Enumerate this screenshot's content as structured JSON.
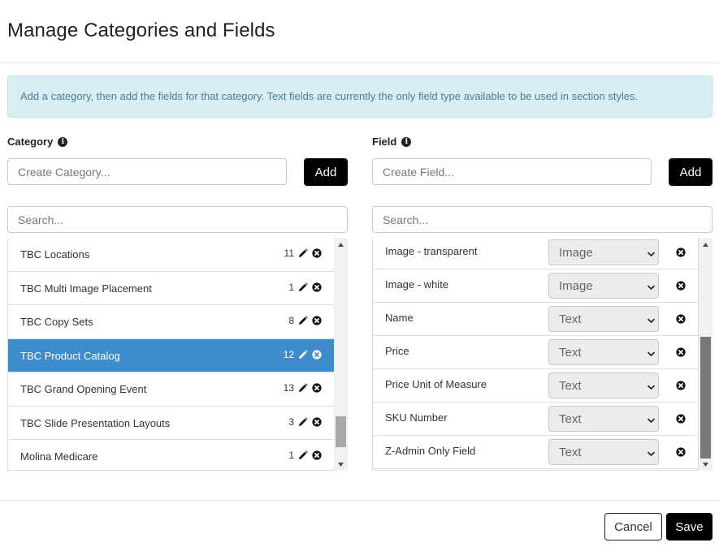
{
  "modal": {
    "title": "Manage Categories and Fields",
    "info_text": "Add a category, then add the fields for that category. Text fields are currently the only field type available to be used in section styles."
  },
  "category": {
    "label": "Category",
    "create_placeholder": "Create Category...",
    "add_label": "Add",
    "search_placeholder": "Search...",
    "items": [
      {
        "name": "TBC Locations",
        "count": "11",
        "active": false
      },
      {
        "name": "TBC Multi Image Placement",
        "count": "1",
        "active": false
      },
      {
        "name": "TBC Copy Sets",
        "count": "8",
        "active": false
      },
      {
        "name": "TBC Product Catalog",
        "count": "12",
        "active": true
      },
      {
        "name": "TBC Grand Opening Event",
        "count": "13",
        "active": false
      },
      {
        "name": "TBC Slide Presentation Layouts",
        "count": "3",
        "active": false
      },
      {
        "name": "Molina Medicare",
        "count": "1",
        "active": false
      }
    ]
  },
  "field": {
    "label": "Field",
    "create_placeholder": "Create Field...",
    "add_label": "Add",
    "search_placeholder": "Search...",
    "items": [
      {
        "name": "Image - transparent",
        "type": "Image"
      },
      {
        "name": "Image - white",
        "type": "Image"
      },
      {
        "name": "Name",
        "type": "Text"
      },
      {
        "name": "Price",
        "type": "Text"
      },
      {
        "name": "Price Unit of Measure",
        "type": "Text"
      },
      {
        "name": "SKU Number",
        "type": "Text"
      },
      {
        "name": "Z-Admin Only Field",
        "type": "Text"
      }
    ]
  },
  "footer": {
    "cancel_label": "Cancel",
    "save_label": "Save"
  },
  "colors": {
    "accent": "#3f8ccd",
    "info_bg": "#d9edf5",
    "info_text": "#4a7d94",
    "primary_button": "#000000"
  },
  "icons": {
    "info": "info-circle-icon",
    "edit": "pencil-icon",
    "remove": "x-circle-icon",
    "dropdown": "chevron-down-icon"
  }
}
